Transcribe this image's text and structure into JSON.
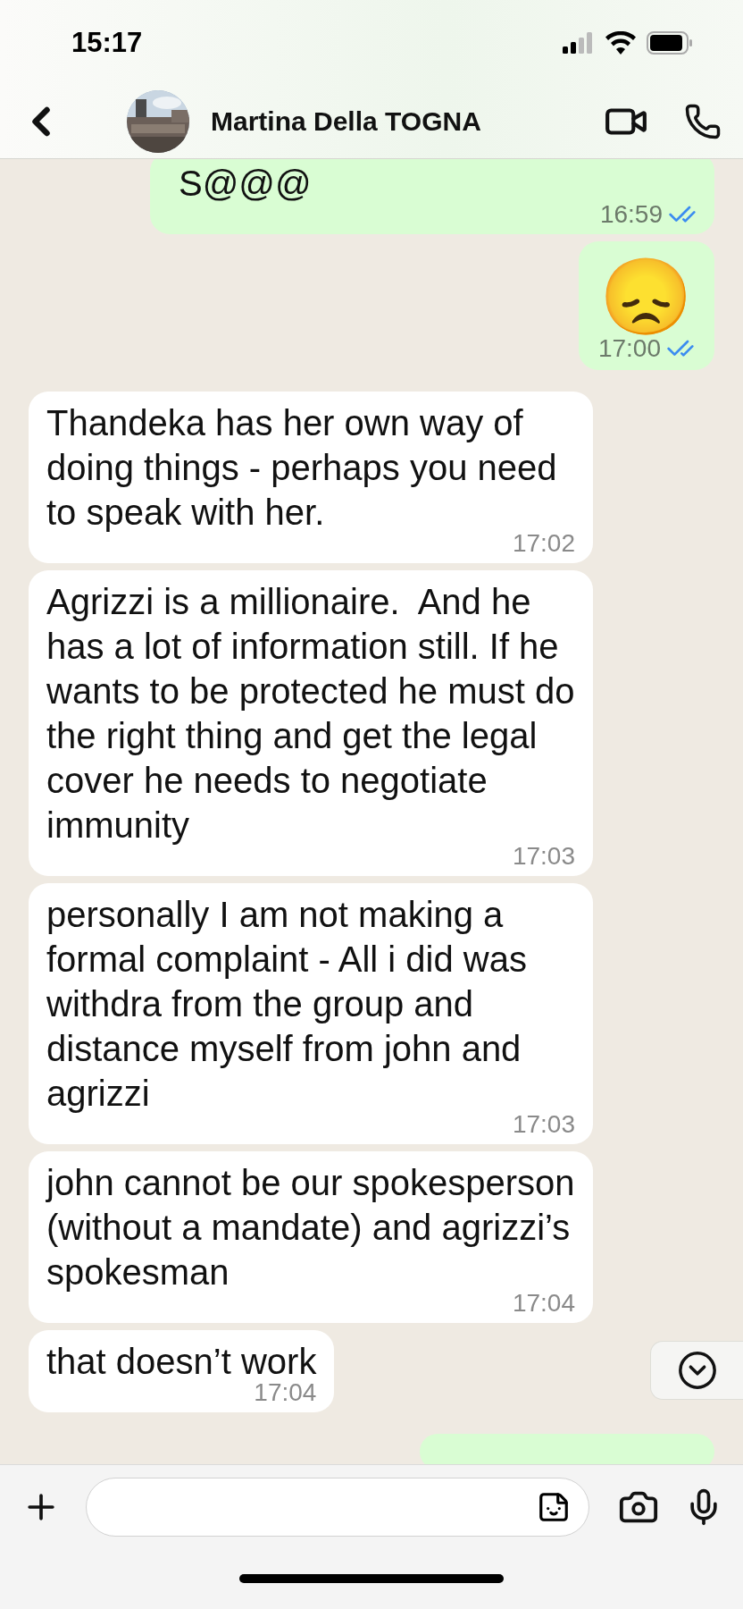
{
  "status_bar": {
    "time": "15:17"
  },
  "header": {
    "name": "Martina Della TOGNA"
  },
  "messages": [
    {
      "kind": "text",
      "outgoing": true,
      "text": "S@@@",
      "time": "16:59",
      "read": true
    },
    {
      "kind": "emoji",
      "outgoing": true,
      "text": "😞",
      "time": "17:00",
      "read": true
    },
    {
      "kind": "text",
      "outgoing": false,
      "text": "Thandeka has her own way of doing things - perhaps you need to speak with her.",
      "time": "17:02"
    },
    {
      "kind": "text",
      "outgoing": false,
      "text": "Agrizzi is a millionaire.  And he has a lot of information still. If he wants to be protected he must do the right thing and get the legal cover he needs to negotiate immunity",
      "time": "17:03"
    },
    {
      "kind": "text",
      "outgoing": false,
      "text": "personally I am not making a formal complaint - All i did was withdra from the group and distance myself from john and agrizzi",
      "time": "17:03"
    },
    {
      "kind": "text",
      "outgoing": false,
      "text": "john cannot be our spokesperson (without a mandate) and agrizzi’s spokesman",
      "time": "17:04"
    },
    {
      "kind": "text",
      "outgoing": false,
      "text": "that doesn’t work",
      "time": "17:04"
    },
    {
      "kind": "cut",
      "outgoing": true
    }
  ]
}
